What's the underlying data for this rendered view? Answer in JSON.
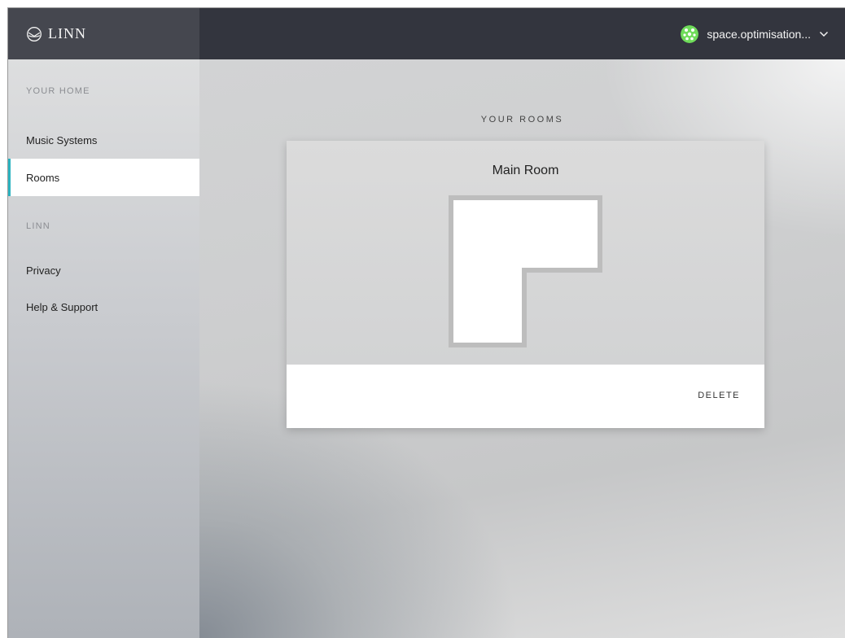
{
  "header": {
    "logo_text": "LINN",
    "user_name": "space.optimisation...",
    "colors": {
      "header_dark": "#33353e",
      "header_left": "#45474f",
      "avatar_green": "#6fdc5a"
    }
  },
  "sidebar": {
    "sections": [
      {
        "label": "YOUR HOME",
        "items": [
          {
            "label": "Music Systems",
            "active": false
          },
          {
            "label": "Rooms",
            "active": true
          }
        ]
      },
      {
        "label": "LINN",
        "items": [
          {
            "label": "Privacy",
            "active": false
          },
          {
            "label": "Help & Support",
            "active": false
          }
        ]
      }
    ],
    "accent_color": "#2bb3c0"
  },
  "main": {
    "section_title": "YOUR ROOMS",
    "rooms": [
      {
        "name": "Main Room",
        "delete_label": "DELETE",
        "icon": "l-shaped-room-floorplan"
      }
    ]
  }
}
